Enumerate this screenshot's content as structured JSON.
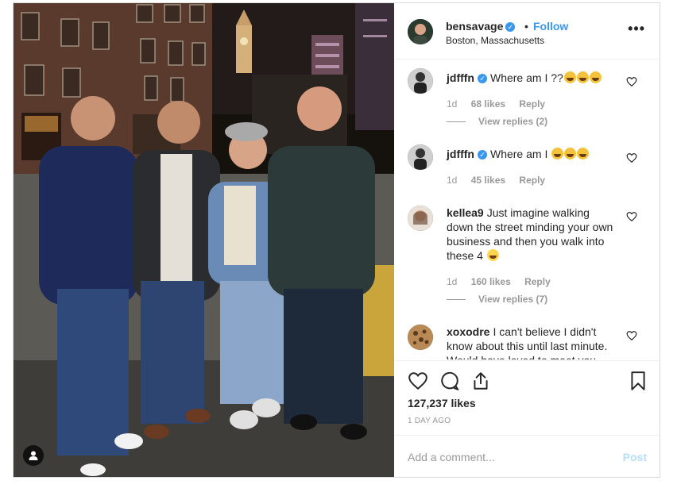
{
  "header": {
    "username": "bensavage",
    "verified_mark": "✓",
    "separator": "•",
    "follow_label": "Follow",
    "location": "Boston, Massachusetts",
    "more_label": "•••"
  },
  "comments": [
    {
      "username": "jdfffn",
      "verified": true,
      "text": "Where am I ??",
      "emoji_count": 3,
      "age": "1d",
      "likes": "68 likes",
      "reply": "Reply",
      "view_replies": "View replies (2)"
    },
    {
      "username": "jdfffn",
      "verified": true,
      "text": "Where am I",
      "emoji_count": 3,
      "age": "1d",
      "likes": "45 likes",
      "reply": "Reply"
    },
    {
      "username": "kellea9",
      "verified": false,
      "text": "Just imagine walking down the street minding your own business and then you walk into these 4",
      "emoji_count": 1,
      "age": "1d",
      "likes": "160 likes",
      "reply": "Reply",
      "view_replies": "View replies (7)"
    },
    {
      "username": "xoxodre",
      "verified": false,
      "text": "I can't believe I didn't know about this until last minute. Would have loved to meet you"
    }
  ],
  "stats": {
    "likes": "127,237 likes",
    "time": "1 DAY AGO"
  },
  "add_comment": {
    "placeholder": "Add a comment...",
    "post_label": "Post"
  },
  "icons": [
    "heart-icon",
    "comment-icon",
    "share-icon",
    "bookmark-icon",
    "user-tag-icon",
    "more-icon"
  ]
}
